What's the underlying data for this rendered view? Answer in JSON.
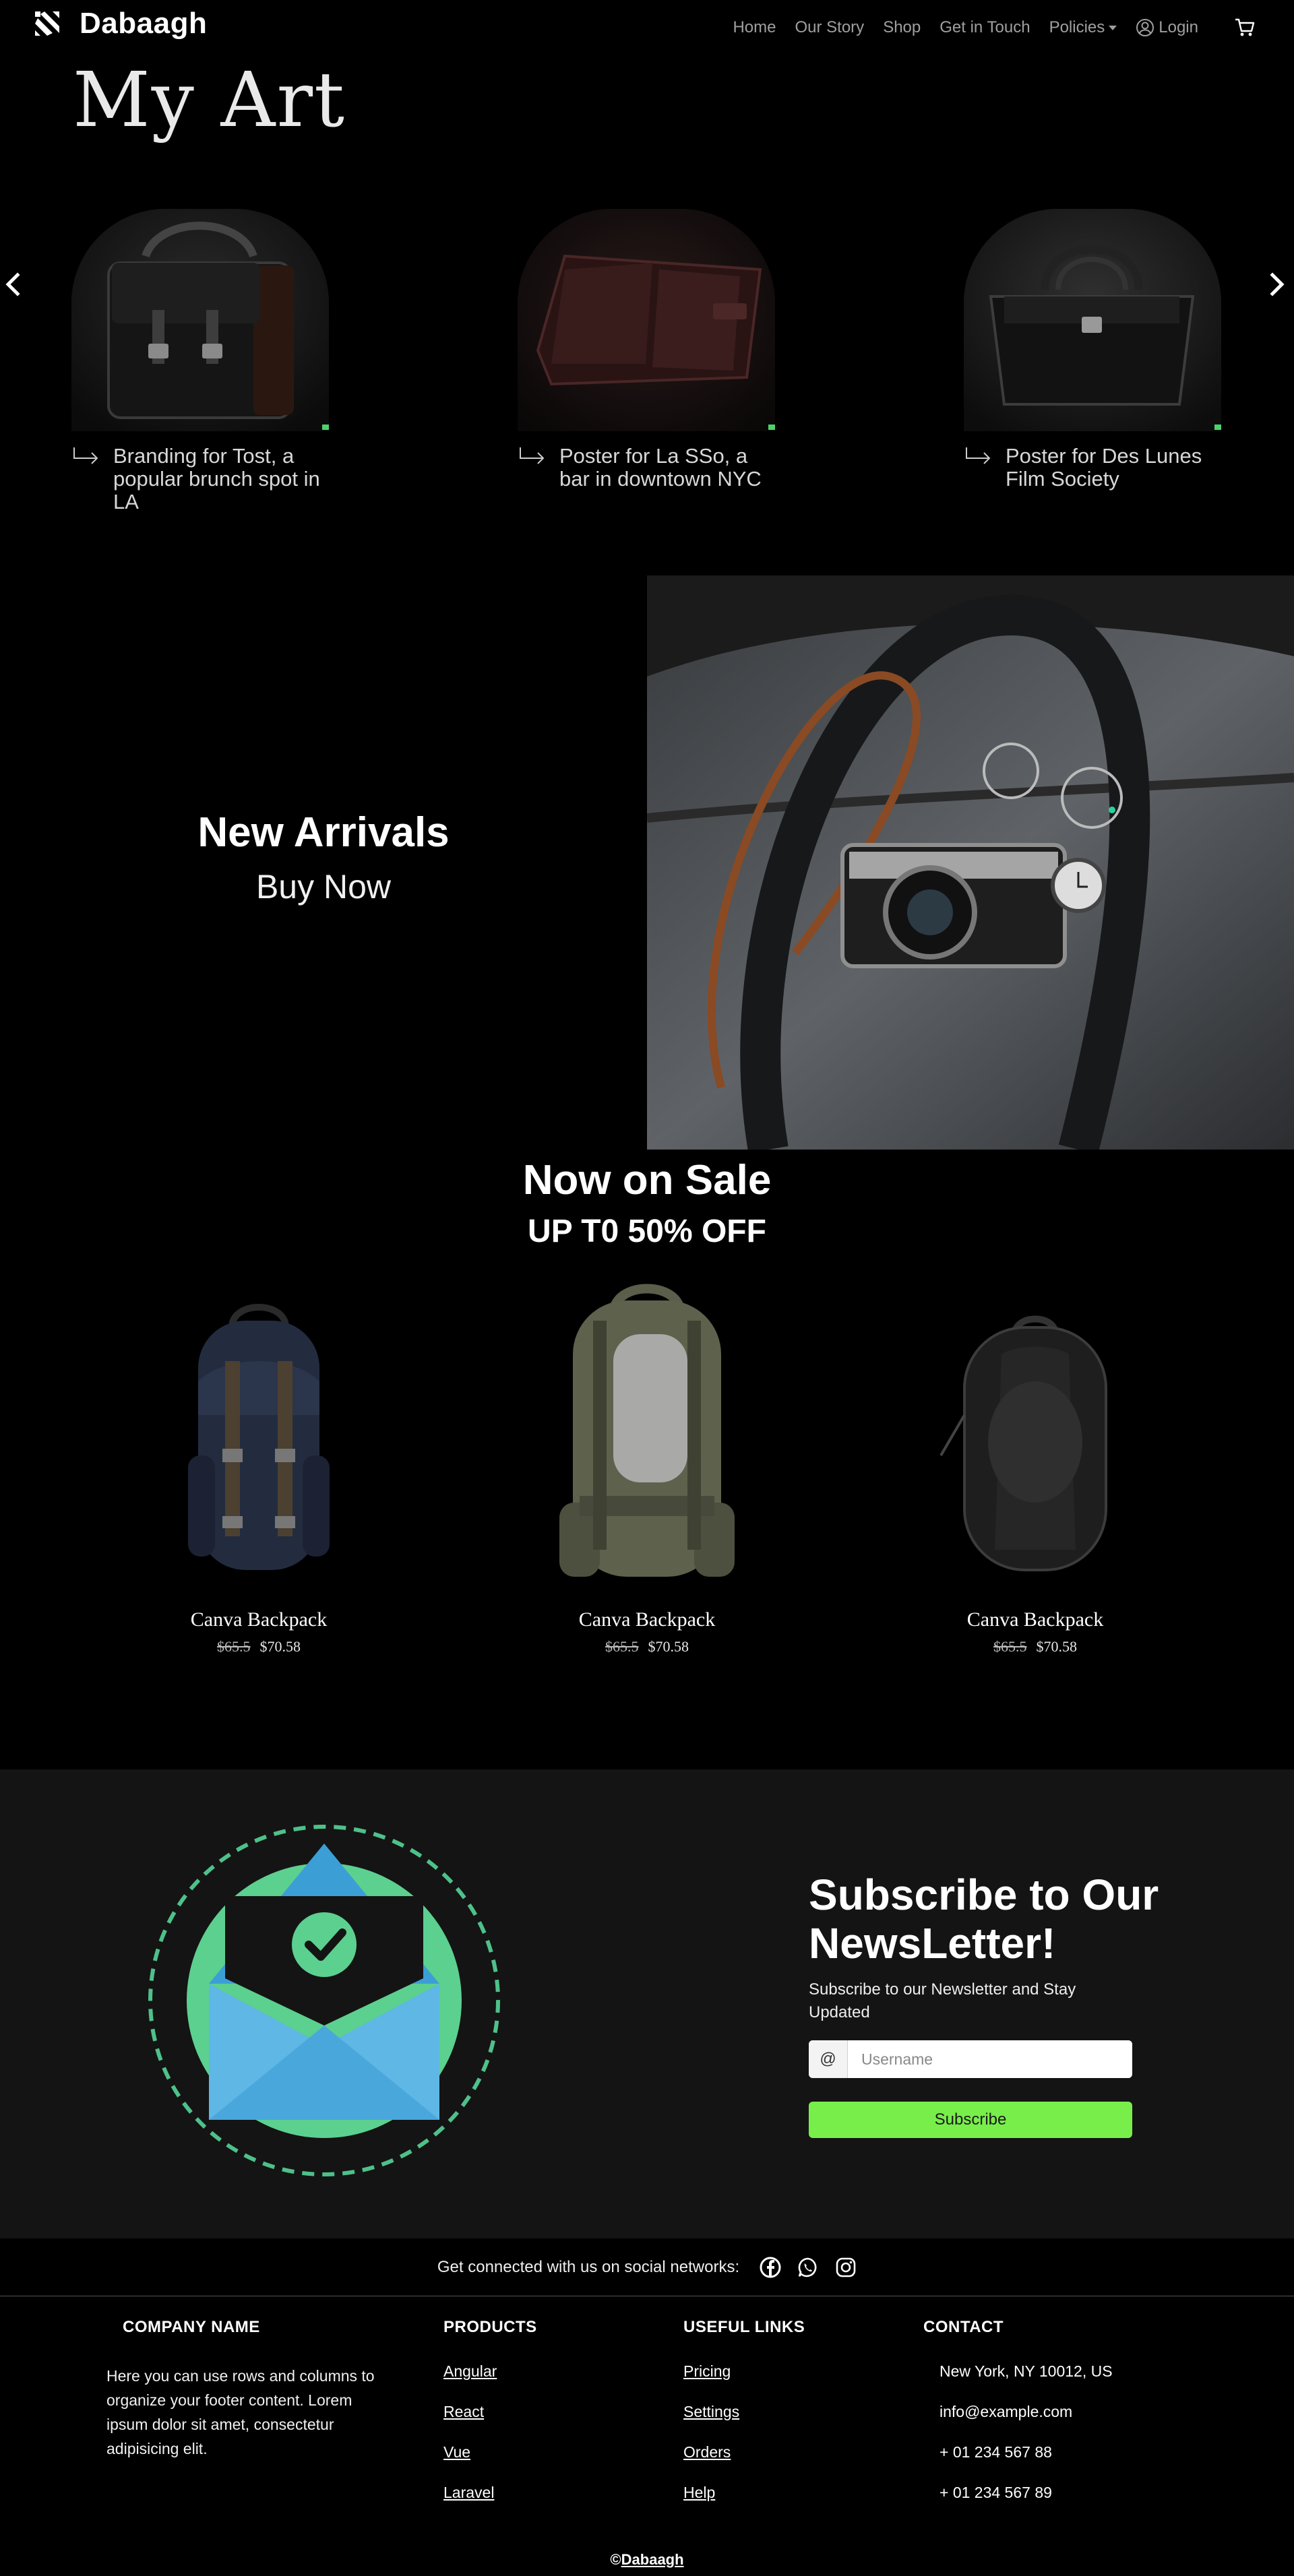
{
  "nav": {
    "brand": "Dabaagh",
    "items": [
      "Home",
      "Our Story",
      "Shop",
      "Get in Touch"
    ],
    "policies": "Policies",
    "login": "Login"
  },
  "hero": {
    "title": "My Art",
    "slides": [
      {
        "caption": "Branding for Tost, a popular brunch spot in LA"
      },
      {
        "caption": "Poster for La SSo, a bar in downtown NYC"
      },
      {
        "caption": "Poster for Des Lunes Film Society"
      }
    ]
  },
  "arrivals": {
    "title": "New Arrivals",
    "subtitle": "Buy Now"
  },
  "sale": {
    "title": "Now on Sale",
    "subtitle": "UP T0 50% OFF",
    "products": [
      {
        "name": "Canva Backpack",
        "old_price": "$65.5",
        "price": "$70.58"
      },
      {
        "name": "Canva Backpack",
        "old_price": "$65.5",
        "price": "$70.58"
      },
      {
        "name": "Canva Backpack",
        "old_price": "$65.5",
        "price": "$70.58"
      }
    ]
  },
  "newsletter": {
    "title": "Subscribe to Our NewsLetter!",
    "description": "Subscribe to our Newsletter and Stay Updated",
    "at": "@",
    "placeholder": "Username",
    "button": "Subscribe"
  },
  "social": {
    "text": "Get connected with us on social networks:"
  },
  "footer": {
    "company": {
      "heading": "COMPANY NAME",
      "text": "Here you can use rows and columns to organize your footer content. Lorem ipsum dolor sit amet, consectetur adipisicing elit."
    },
    "products": {
      "heading": "PRODUCTS",
      "links": [
        "Angular",
        "React",
        "Vue",
        "Laravel"
      ]
    },
    "useful": {
      "heading": "USEFUL LINKS",
      "links": [
        "Pricing",
        "Settings",
        "Orders",
        "Help"
      ]
    },
    "contact": {
      "heading": "CONTACT",
      "items": [
        "New York, NY 10012, US",
        "info@example.com",
        "+ 01 234 567 88",
        "+ 01 234 567 89"
      ]
    },
    "copyright_symbol": "©",
    "copyright_brand": "Dabaagh"
  },
  "colors": {
    "accent_green": "#78ee4a",
    "newsletter_bg": "#141414"
  }
}
